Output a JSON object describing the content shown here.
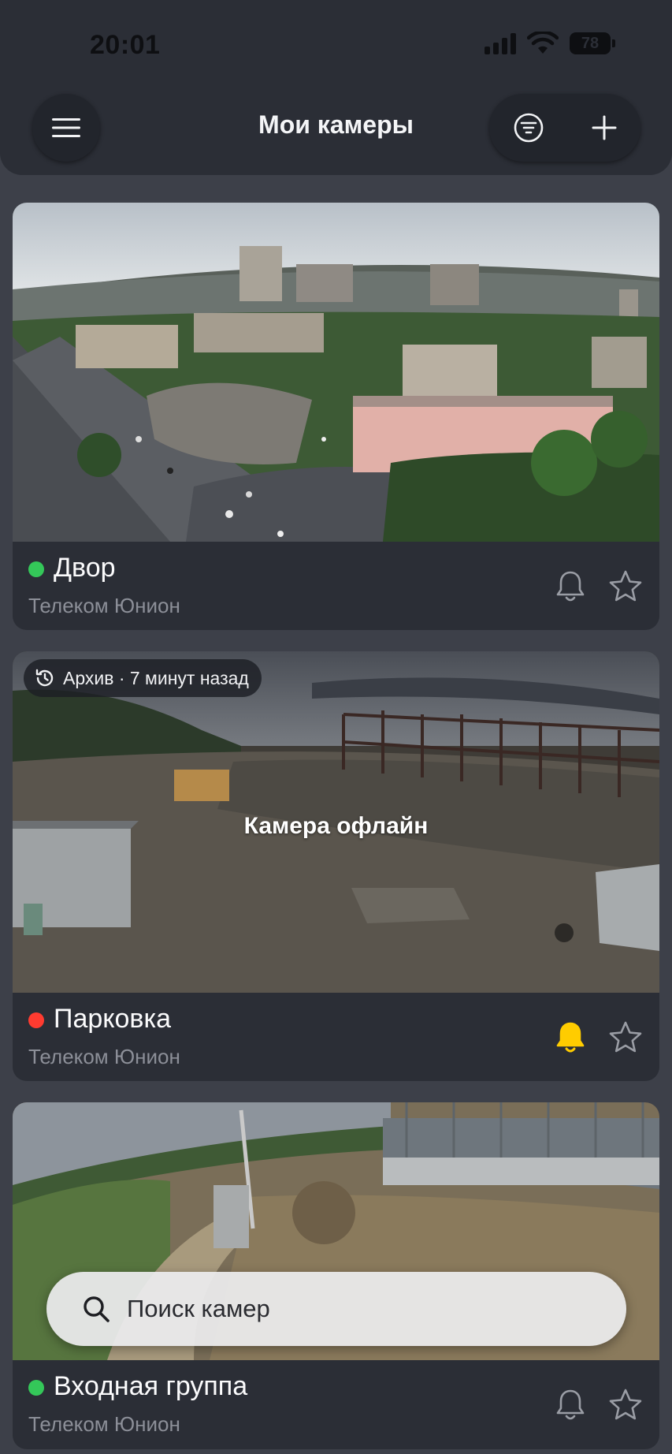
{
  "status_bar": {
    "time": "20:01",
    "battery": "78"
  },
  "header": {
    "title": "Мои камеры"
  },
  "cameras": [
    {
      "name": "Двор",
      "provider": "Телеком Юнион",
      "status_color": "#34c759",
      "bell_active": false
    },
    {
      "name": "Парковка",
      "provider": "Телеком Юнион",
      "status_color": "#ff3b30",
      "bell_active": true,
      "archive_label": "Архив · 7 минут назад",
      "overlay_text": "Камера офлайн"
    },
    {
      "name": "Входная группа",
      "provider": "Телеком Юнион",
      "status_color": "#34c759",
      "bell_active": false
    }
  ],
  "search": {
    "placeholder": "Поиск камер"
  },
  "colors": {
    "bell_active": "#ffcc00",
    "icon_inactive": "#9a9da5",
    "background": "#3d4049",
    "card": "#2b2e36"
  },
  "icons": [
    "menu-icon",
    "filter-icon",
    "plus-icon",
    "bell-icon",
    "star-icon",
    "history-icon",
    "search-icon"
  ]
}
